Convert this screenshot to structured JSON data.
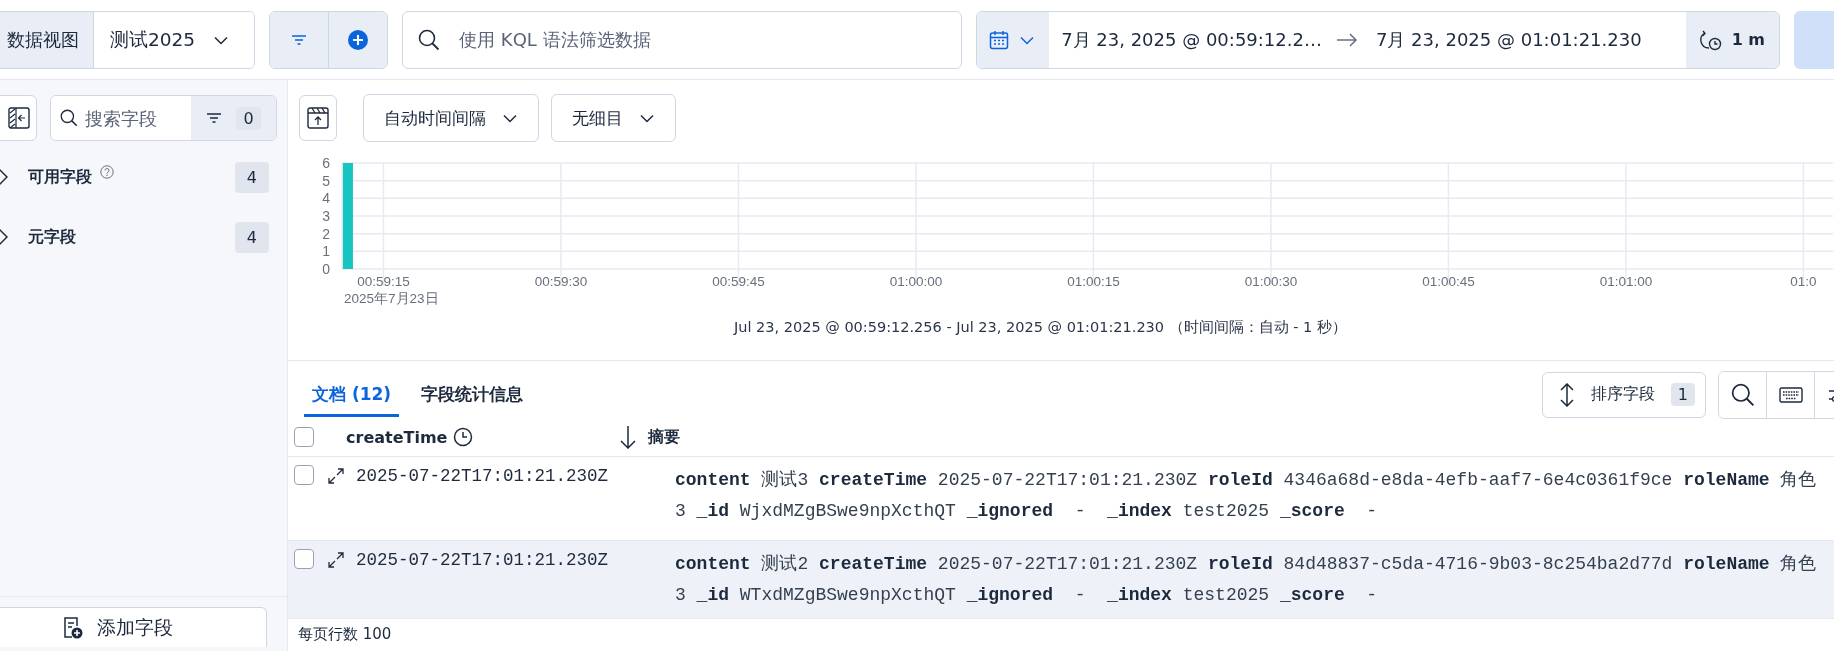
{
  "top_bar": {
    "data_view_label": "数据视图",
    "data_view": "测试2025",
    "query": {
      "placeholder": "使用 KQL 语法筛选数据"
    },
    "date_start": "7月 23, 2025 @ 00:59:12.2…",
    "date_end": "7月 23, 2025 @ 01:01:21.230",
    "refresh_interval": "1 m"
  },
  "sidebar": {
    "search": {
      "placeholder": "搜索字段"
    },
    "filter_count": "0",
    "groups": [
      {
        "label": "可用字段",
        "count": "4",
        "help": true
      },
      {
        "label": "元字段",
        "count": "4",
        "help": false
      }
    ],
    "add_field": "添加字段"
  },
  "chart_toolbar": {
    "interval": "自动时间间隔",
    "breakdown": "无细目"
  },
  "chart": {
    "chart_data": {
      "type": "bar",
      "grid": true,
      "ylim": [
        0,
        6
      ],
      "yticks": [
        0,
        1,
        2,
        3,
        4,
        5,
        6
      ],
      "categories": [
        null,
        null,
        null,
        "00:59:15",
        null,
        null,
        null,
        null,
        null,
        null,
        null,
        null,
        null,
        null,
        null,
        null,
        null,
        null,
        "00:59:30",
        null,
        null,
        null,
        null,
        null,
        null,
        null,
        null,
        null,
        null,
        null,
        null,
        null,
        null,
        "00:59:45",
        null,
        null,
        null,
        null,
        null,
        null,
        null,
        null,
        null,
        null,
        null,
        null,
        null,
        null,
        "01:00:00",
        null,
        null,
        null,
        null,
        null,
        null,
        null,
        null,
        null,
        null,
        null,
        null,
        null,
        null,
        "01:00:15",
        null,
        null,
        null,
        null,
        null,
        null,
        null,
        null,
        null,
        null,
        null,
        null,
        null,
        null,
        "01:00:30",
        null,
        null,
        null,
        null,
        null,
        null,
        null,
        null,
        null,
        null,
        null,
        null,
        null,
        null,
        "01:00:45",
        null,
        null,
        null,
        null,
        null,
        null,
        null,
        null,
        null,
        null,
        null,
        null,
        null,
        null,
        "01:01:00",
        null,
        null,
        null,
        null,
        null,
        null,
        null,
        null,
        null,
        null,
        null,
        null,
        null,
        null,
        "01:0",
        null,
        null
      ],
      "values": [
        6,
        null,
        null,
        null,
        null,
        null,
        null,
        null,
        null,
        null,
        null,
        null,
        null,
        null,
        null,
        null,
        null,
        null,
        null,
        null,
        null,
        null,
        null,
        null,
        null,
        null,
        null,
        null,
        null,
        null,
        null,
        null,
        null,
        null,
        null,
        null,
        null,
        null,
        null,
        null,
        null,
        null,
        null,
        null,
        null,
        null,
        null,
        null,
        null,
        null,
        null,
        null,
        null,
        null,
        null,
        null,
        null,
        null,
        null,
        null,
        null,
        null,
        null,
        null,
        null,
        null,
        null,
        null,
        null,
        null,
        null,
        null,
        null,
        null,
        null,
        null,
        null,
        null,
        null,
        null,
        null,
        null,
        null,
        null,
        null,
        null,
        null,
        null,
        null,
        null,
        null,
        null,
        null,
        null,
        null,
        null,
        null,
        null,
        null,
        null,
        null,
        null,
        null,
        null,
        null,
        null,
        null,
        null,
        null,
        null,
        null,
        null,
        null,
        null,
        null,
        null,
        null,
        null,
        null,
        null,
        null,
        null,
        null,
        null,
        null,
        null
      ]
    },
    "date_label": "2025年7月23日",
    "range": "Jul 23, 2025 @ 00:59:12.256 - Jul 23, 2025 @ 01:01:21.230 （时间间隔：自动 - 1 秒）"
  },
  "tabs": [
    {
      "label": "文档 (12)",
      "selected": true
    },
    {
      "label": "字段统计信息",
      "selected": false
    }
  ],
  "sort_button": {
    "label": "排序字段",
    "count": "1"
  },
  "table": {
    "select_all": {
      "checked": false
    },
    "columns": [
      "createTime",
      "摘要"
    ],
    "rows": [
      {
        "checked": false,
        "hovered": false,
        "time": "2025-07-22T17:01:21.230Z",
        "summary": [
          "**content** 测试3 **createTime** 2025-07-22T17:01:21.230Z **roleId** 4346a68d-e8da-4efb-aaf7-6e4c0361f9ce **roleName** 角色",
          "3 **_id** WjxdMZgBSwe9npXcthQT **_ignored**  -  **_index** test2025 **_score**  -"
        ]
      },
      {
        "checked": false,
        "hovered": true,
        "time": "2025-07-22T17:01:21.230Z",
        "summary": [
          "**content** 测试2 **createTime** 2025-07-22T17:01:21.230Z **roleId** 84d48837-c5da-4716-9b03-8c254ba2d77d **roleName** 角色",
          "3 **_id** WTxdMZgBSwe9npXcthQT **_ignored**  -  **_index** test2025 **_score**  -"
        ]
      }
    ]
  },
  "footer": {
    "rows_per_page": "每页行数 100"
  }
}
